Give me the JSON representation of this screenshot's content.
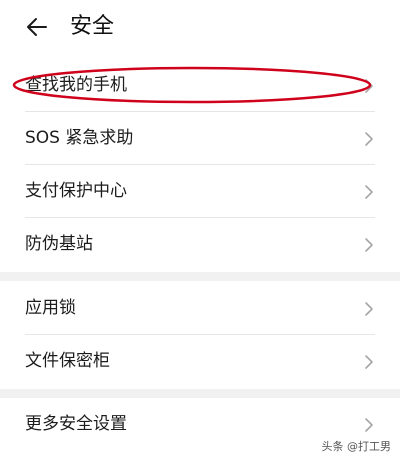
{
  "header": {
    "title": "安全",
    "back_icon": "arrow-left-icon"
  },
  "group1": [
    {
      "label": "查找我的手机"
    },
    {
      "label": "SOS 紧急求助"
    },
    {
      "label": "支付保护中心"
    },
    {
      "label": "防伪基站"
    }
  ],
  "group2": [
    {
      "label": "应用锁"
    },
    {
      "label": "文件保密柜"
    }
  ],
  "group3": [
    {
      "label": "更多安全设置"
    }
  ],
  "annotation": {
    "color": "#d0021b",
    "target": "查找我的手机"
  },
  "watermark": "头条 @打工男"
}
